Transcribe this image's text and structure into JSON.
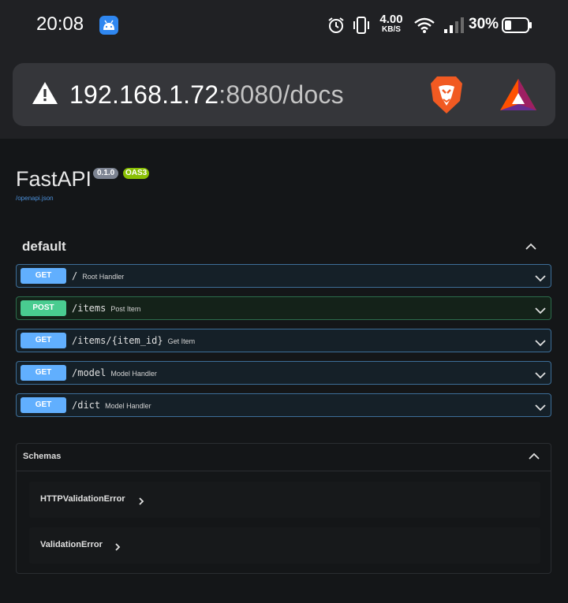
{
  "status_bar": {
    "time": "20:08",
    "net_speed_value": "4.00",
    "net_speed_unit": "KB/S",
    "battery_percent": "30%",
    "icons": [
      "app-notification-icon",
      "alarm-icon",
      "vibrate-icon",
      "wifi-icon",
      "signal-icon",
      "battery-icon"
    ]
  },
  "browser": {
    "url_host": "192.168.1.72",
    "url_rest": ":8080/docs",
    "icons": [
      "not-secure-warning-icon",
      "brave-shields-icon",
      "brave-rewards-icon"
    ]
  },
  "page": {
    "title": "FastAPI",
    "version_badge": "0.1.0",
    "oas_badge": "OAS3",
    "spec_link": "/openapi.json",
    "section_title": "default",
    "operations": [
      {
        "method": "GET",
        "path": "/",
        "summary": "Root Handler"
      },
      {
        "method": "POST",
        "path": "/items",
        "summary": "Post Item"
      },
      {
        "method": "GET",
        "path": "/items/{item_id}",
        "summary": "Get Item"
      },
      {
        "method": "GET",
        "path": "/model",
        "summary": "Model Handler"
      },
      {
        "method": "GET",
        "path": "/dict",
        "summary": "Model Handler"
      }
    ],
    "schemas_title": "Schemas",
    "schemas": [
      {
        "name": "HTTPValidationError"
      },
      {
        "name": "ValidationError"
      }
    ]
  },
  "colors": {
    "get": "#61affe",
    "post": "#49cc90",
    "background": "#141618"
  }
}
